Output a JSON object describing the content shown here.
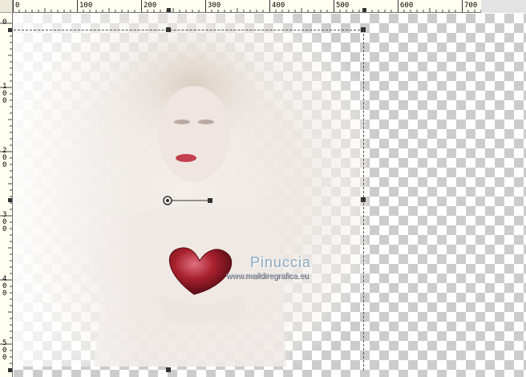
{
  "rulers": {
    "top_labels": [
      "0",
      "100",
      "200",
      "300",
      "400",
      "500",
      "600",
      "700"
    ],
    "left_labels": [
      "0",
      "100",
      "200",
      "300",
      "400",
      "500"
    ]
  },
  "watermark": {
    "name": "Pinuccia",
    "url": "www.maildiregrafica.eu"
  },
  "colors": {
    "ruler_bg": "#fffef0",
    "checker_dark": "#cccccc",
    "checker_light": "#ffffff",
    "heart": "#9b1b26"
  },
  "icons": {
    "rotation_pivot": "rotation-pivot-icon",
    "handle": "square-handle-icon"
  }
}
